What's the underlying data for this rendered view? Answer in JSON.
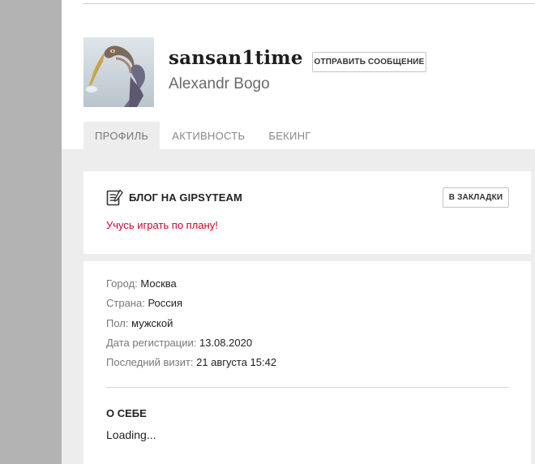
{
  "profile": {
    "username": "sansan1time",
    "full_name": "Alexandr Bogo",
    "message_button": "ОТПРАВИТЬ СООБЩЕНИЕ"
  },
  "tabs": [
    {
      "label": "ПРОФИЛЬ",
      "active": true
    },
    {
      "label": "АКТИВНОСТЬ",
      "active": false
    },
    {
      "label": "БЕКИНГ",
      "active": false
    }
  ],
  "blog": {
    "icon": "blog-icon",
    "title": "БЛОГ НА GIPSYTEAM",
    "bookmark_button": "В ЗАКЛАДКИ",
    "link_text": "Учусь играть по плану!"
  },
  "info": {
    "city_label": "Город:",
    "city": "Москва",
    "country_label": "Страна:",
    "country": "Россия",
    "gender_label": "Пол:",
    "gender": "мужской",
    "registered_label": "Дата регистрации:",
    "registered": "13.08.2020",
    "last_visit_label": "Последний визит:",
    "last_visit": "21 августа 15:42"
  },
  "about": {
    "title": "О СЕБЕ",
    "text": "Loading..."
  },
  "colors": {
    "accent_link": "#d0022a",
    "page_bg": "#ededed",
    "gutter": "#b3b3b3"
  }
}
